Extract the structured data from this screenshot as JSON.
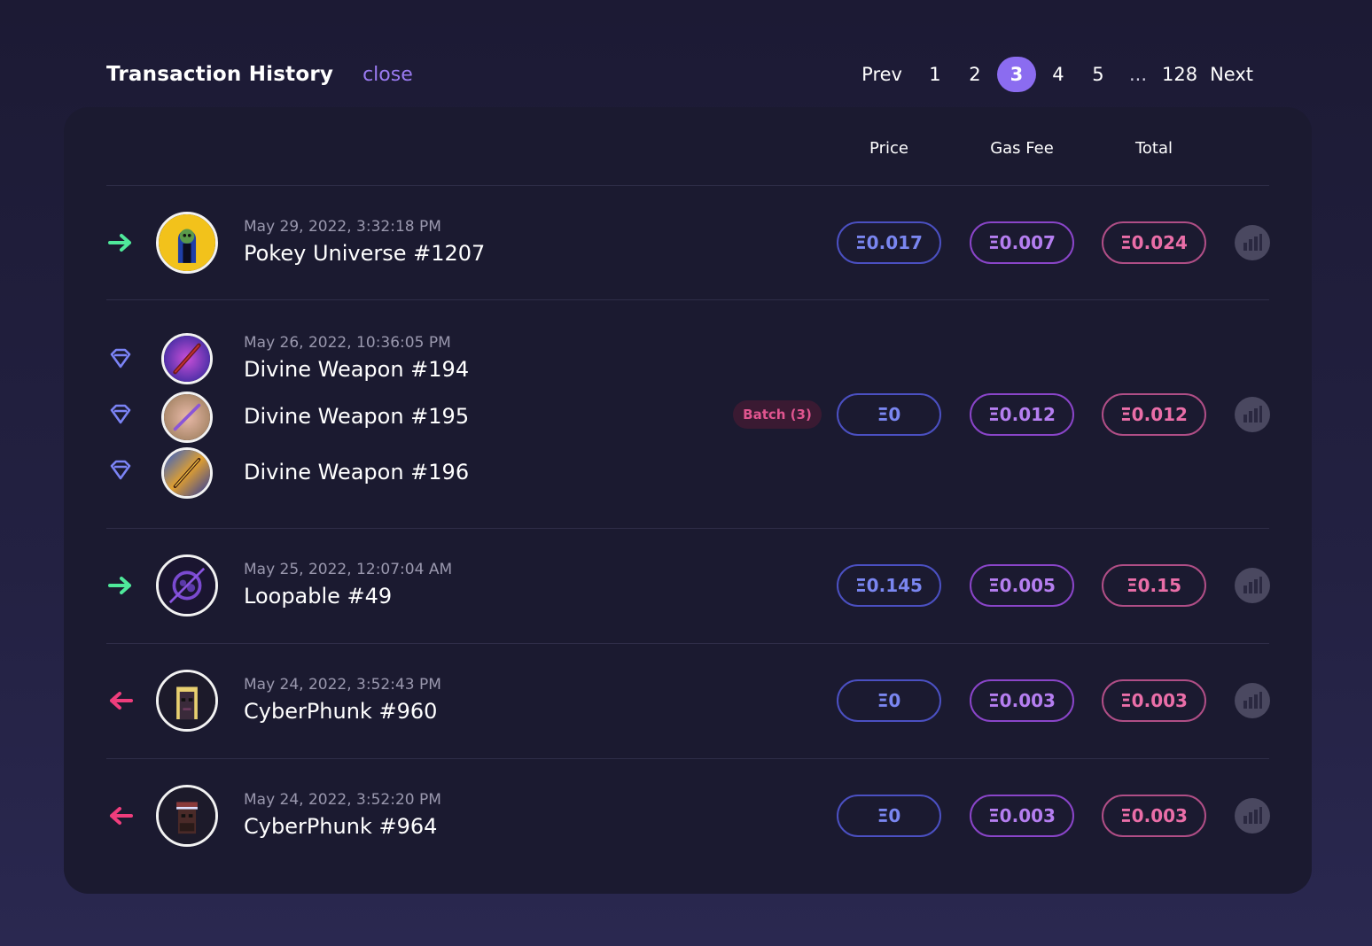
{
  "header": {
    "title": "Transaction History",
    "close_label": "close"
  },
  "pagination": {
    "prev_label": "Prev",
    "next_label": "Next",
    "pages": [
      "1",
      "2",
      "3",
      "4",
      "5",
      "...",
      "128"
    ],
    "current": "3"
  },
  "columns": {
    "price": "Price",
    "gas_fee": "Gas Fee",
    "total": "Total"
  },
  "colors": {
    "incoming": "#4fe89a",
    "outgoing": "#ef3d7c",
    "mint": "#7b83f5",
    "accent": "#8b6cf0"
  },
  "transactions": [
    {
      "direction": "incoming-arrow",
      "date": "May 29, 2022, 3:32:18 PM",
      "name": "Pokey Universe #1207",
      "price": "Ξ0.017",
      "gas_fee": "Ξ0.007",
      "total": "Ξ0.024"
    },
    {
      "direction": "diamond",
      "date": "May 26, 2022, 10:36:05 PM",
      "items": [
        {
          "name": "Divine Weapon #194"
        },
        {
          "name": "Divine Weapon #195"
        },
        {
          "name": "Divine Weapon #196"
        }
      ],
      "batch_label": "Batch (3)",
      "price": "Ξ0",
      "gas_fee": "Ξ0.012",
      "total": "Ξ0.012"
    },
    {
      "direction": "incoming-arrow",
      "date": "May 25, 2022, 12:07:04 AM",
      "name": "Loopable #49",
      "price": "Ξ0.145",
      "gas_fee": "Ξ0.005",
      "total": "Ξ0.15"
    },
    {
      "direction": "outgoing-arrow",
      "date": "May 24, 2022, 3:52:43 PM",
      "name": "CyberPhunk #960",
      "price": "Ξ0",
      "gas_fee": "Ξ0.003",
      "total": "Ξ0.003"
    },
    {
      "direction": "outgoing-arrow",
      "date": "May 24, 2022, 3:52:20 PM",
      "name": "CyberPhunk #964",
      "price": "Ξ0",
      "gas_fee": "Ξ0.003",
      "total": "Ξ0.003"
    }
  ]
}
